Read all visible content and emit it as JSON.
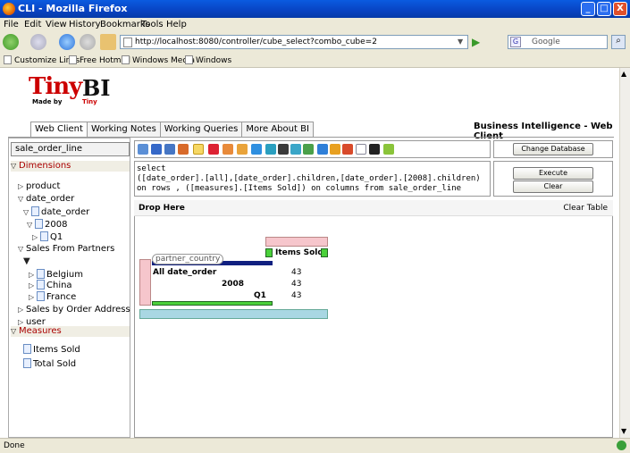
{
  "window": {
    "title": "CLI - Mozilla Firefox",
    "min": "_",
    "max": "□",
    "close": "X"
  },
  "menu": [
    "File",
    "Edit",
    "View",
    "History",
    "Bookmarks",
    "Tools",
    "Help"
  ],
  "nav": {
    "url": "http://localhost:8080/controller/cube_select?combo_cube=2",
    "search_placeholder": "Google"
  },
  "bookmarks": [
    "Customize Links",
    "Free Hotmail",
    "Windows Media",
    "Windows"
  ],
  "logo": {
    "brand1": "Tiny",
    "brand2": "BI",
    "made_by": "Made by",
    "made_by_brand": "Tiny"
  },
  "tabs": [
    "Web Client",
    "Working Notes",
    "Working Queries",
    "More About BI"
  ],
  "app_title": "Business Intelligence - Web Client",
  "cube": "sale_order_line",
  "dimensions_label": "Dimensions",
  "tree": [
    "product",
    "date_order",
    "date_order",
    "2008",
    "Q1",
    "Sales From Partners",
    "Belgium",
    "China",
    "France",
    "Sales by Order Address",
    "user"
  ],
  "measures_label": "Measures",
  "measures": [
    "Items Sold",
    "Total Sold"
  ],
  "query": "select\n([date_order].[all],[date_order].children,[date_order].[2008].children)\non rows , ([measures].[Items Sold]) on columns from sale_order_line",
  "buttons": {
    "change_db": "Change Database",
    "execute": "Execute",
    "clear": "Clear"
  },
  "drop": {
    "label": "Drop Here",
    "clear_table": "Clear Table",
    "partner_dim": "partner_country",
    "col_header": "Items Sold",
    "rows": [
      {
        "label": "All date_order",
        "value": "43"
      },
      {
        "label": "2008",
        "value": "43"
      },
      {
        "label": "Q1",
        "value": "43"
      }
    ]
  },
  "status": "Done"
}
